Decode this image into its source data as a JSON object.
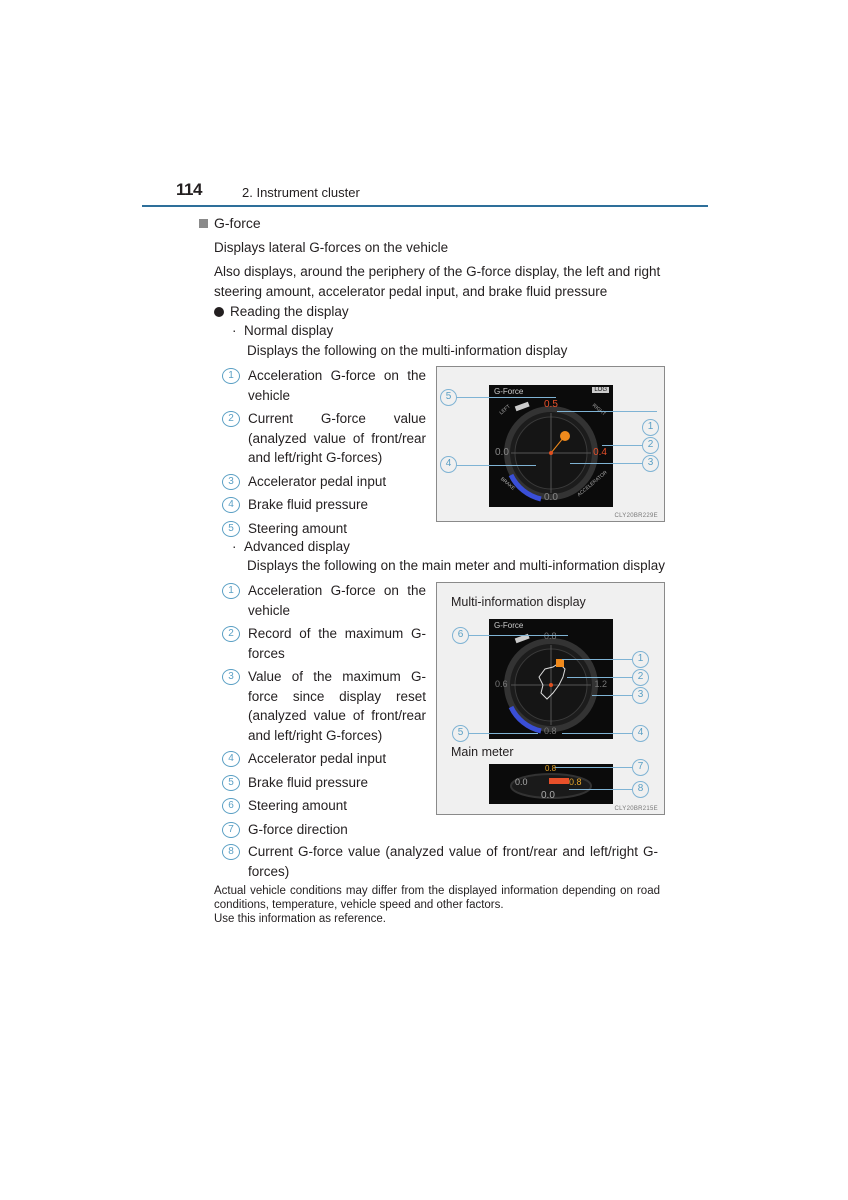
{
  "header": {
    "page_number": "114",
    "chapter": "2. Instrument cluster"
  },
  "section": {
    "title": "G-force",
    "intro": "Displays lateral G-forces on the vehicle",
    "description": "Also displays, around the periphery of the G-force display, the left and right steering amount, accelerator pedal input, and brake fluid pressure",
    "reading_heading": "Reading the display"
  },
  "normal_display": {
    "heading": "Normal display",
    "subtext": "Displays the following on the multi-information display",
    "items": [
      {
        "num": "1",
        "text": "Acceleration G-force on the vehicle"
      },
      {
        "num": "2",
        "text": "Current G-force value (analyzed value of front/rear and left/right G-forces)"
      },
      {
        "num": "3",
        "text": "Accelerator pedal input"
      },
      {
        "num": "4",
        "text": "Brake fluid pressure"
      },
      {
        "num": "5",
        "text": "Steering amount"
      }
    ],
    "figure": {
      "screen_title": "G-Force",
      "badge": "LOG",
      "top_value": "0.5",
      "left_value": "0.0",
      "right_value": "0.4",
      "bottom_value": "0.0",
      "label_left": "LEFT",
      "label_right": "RIGHT",
      "label_brake": "BRAKE",
      "label_accel": "ACCELERATOR",
      "code": "CLY20BR229E",
      "callouts": [
        "1",
        "2",
        "3",
        "4",
        "5"
      ]
    }
  },
  "advanced_display": {
    "heading": "Advanced display",
    "subtext": "Displays the following on the main meter and multi-information display",
    "items": [
      {
        "num": "1",
        "text": "Acceleration G-force on the vehicle"
      },
      {
        "num": "2",
        "text": "Record of the maximum G-forces"
      },
      {
        "num": "3",
        "text": "Value of the maximum G-force since display reset (analyzed value of front/rear and left/right G-forces)"
      },
      {
        "num": "4",
        "text": "Accelerator pedal input"
      },
      {
        "num": "5",
        "text": "Brake fluid pressure"
      },
      {
        "num": "6",
        "text": "Steering amount"
      },
      {
        "num": "7",
        "text": "G-force direction"
      },
      {
        "num": "8",
        "text": "Current G-force value (analyzed value of front/rear and left/right G-forces)"
      }
    ],
    "figure": {
      "mid_label": "Multi-information display",
      "main_meter_label": "Main meter",
      "screen_title": "G-Force",
      "top_value": "0.8",
      "left_value": "0.6",
      "right_value": "1.2",
      "bottom_value": "0.8",
      "meter_top": "0.8",
      "meter_left": "0.0",
      "meter_right": "0.8",
      "meter_bottom": "0.0",
      "code": "CLY20BR215E",
      "callouts": [
        "1",
        "2",
        "3",
        "4",
        "5",
        "6",
        "7",
        "8"
      ]
    }
  },
  "note": {
    "line1": "Actual vehicle conditions may differ from the displayed information depending on road conditions, temperature, vehicle speed and other factors.",
    "line2": "Use this information as reference."
  },
  "colors": {
    "rule": "#2e6f9a",
    "callout": "#5a9fc4",
    "orange": "#f08a1c",
    "brake_blue": "#3a4fd8"
  }
}
